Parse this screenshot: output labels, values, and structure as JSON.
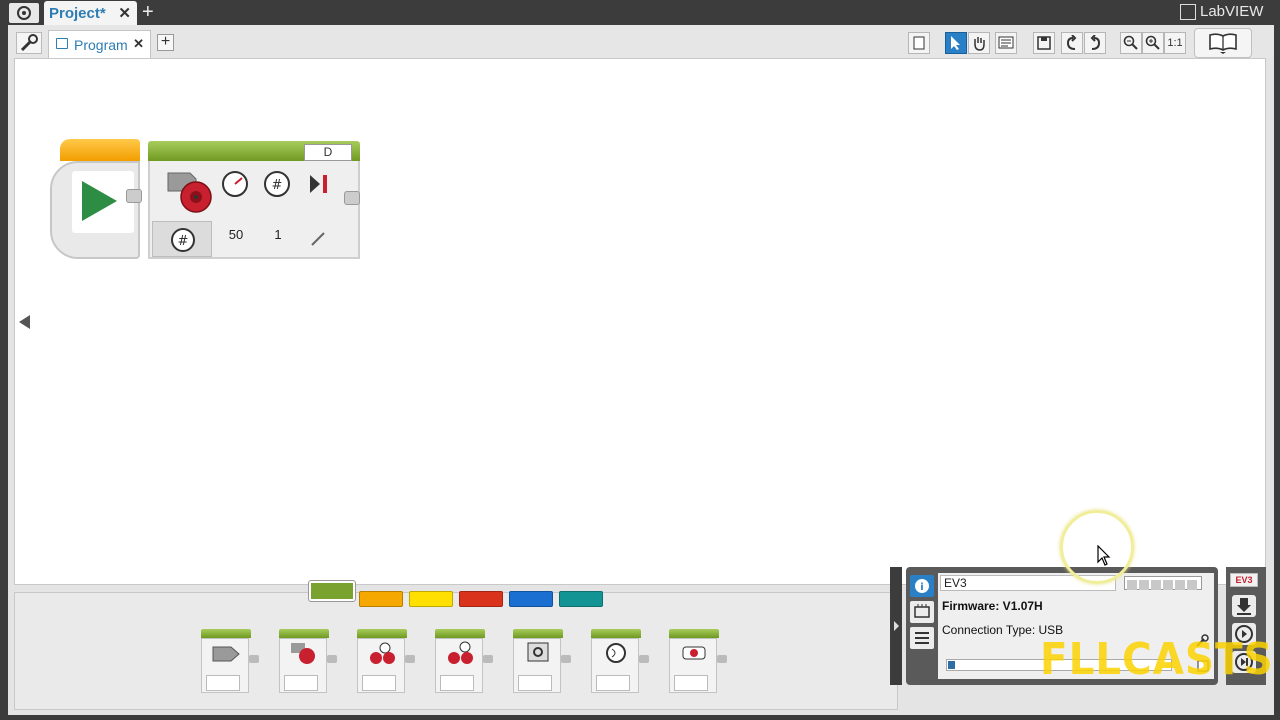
{
  "project": {
    "tab_label": "Project*",
    "close_glyph": "✕",
    "add_glyph": "+"
  },
  "brand": {
    "label": "LabVIEW"
  },
  "program_tab": {
    "label": "Program",
    "close_glyph": "✕",
    "add_glyph": "+"
  },
  "toolbar": {
    "zoom_reset_label": "1:1"
  },
  "motor_block": {
    "port": "D",
    "power": "50",
    "rotations": "1"
  },
  "palette": {
    "category_colors": [
      "#7aa22f",
      "#f5a800",
      "#ffe000",
      "#d9331c",
      "#1a6fd1",
      "#129494"
    ],
    "selected_index": 0
  },
  "hardware": {
    "brick_name": "EV3",
    "firmware": "Firmware: V1.07H",
    "connection": "Connection Type: USB",
    "badge": "EV3",
    "progress": 0.03
  },
  "watermark": "FLLCASTS"
}
